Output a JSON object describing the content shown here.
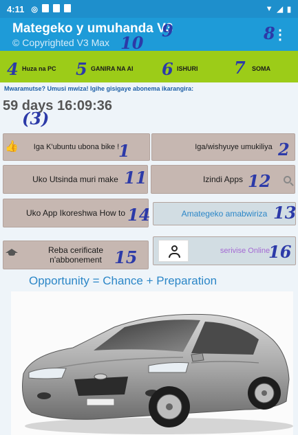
{
  "status_bar": {
    "time": "4:11"
  },
  "app_bar": {
    "title": "Mategeko y umuhanda V3",
    "subtitle": "© Copyrighted  V3  Max",
    "menu_icon": "more-vertical-icon"
  },
  "annotations": [
    "1",
    "2",
    "(3)",
    "4",
    "5",
    "6",
    "7",
    "8",
    "9",
    "10",
    "11",
    "12",
    "13",
    "14",
    "15",
    "16"
  ],
  "tabs": [
    {
      "label": "Huza na PC"
    },
    {
      "label": "GANIRA NA AI"
    },
    {
      "label": "ISHURI"
    },
    {
      "label": "SOMA"
    }
  ],
  "motto": "Mwaramutse? Umusi mwiza! Igihe gisigaye abonema  ikarangira:",
  "countdown": "59 days 16:09:36",
  "buttons": {
    "iga_kubuntu": "Iga K'ubuntu ubona bike !",
    "iga_wishyuye": "Iga/wishyuye  umukiliya",
    "uko_utsinda": "Uko Utsinda muri make",
    "izindi_apps": "Izindi Apps",
    "uko_app": "Uko App Ikoreshwa How to",
    "amategeko": "Amategeko  amabwiriza",
    "reba_cert_line1": "Reba cerificate",
    "reba_cert_line2": "n'abbonement",
    "serivise": "serivise Online"
  },
  "opportunity": "Opportunity = Chance + Preparation",
  "colors": {
    "status_bar": "#1e8fcc",
    "app_bar": "#1e9bd8",
    "green_bar": "#9ccc18",
    "button": "#c6b7b1",
    "annotation": "#2c3aa8"
  }
}
